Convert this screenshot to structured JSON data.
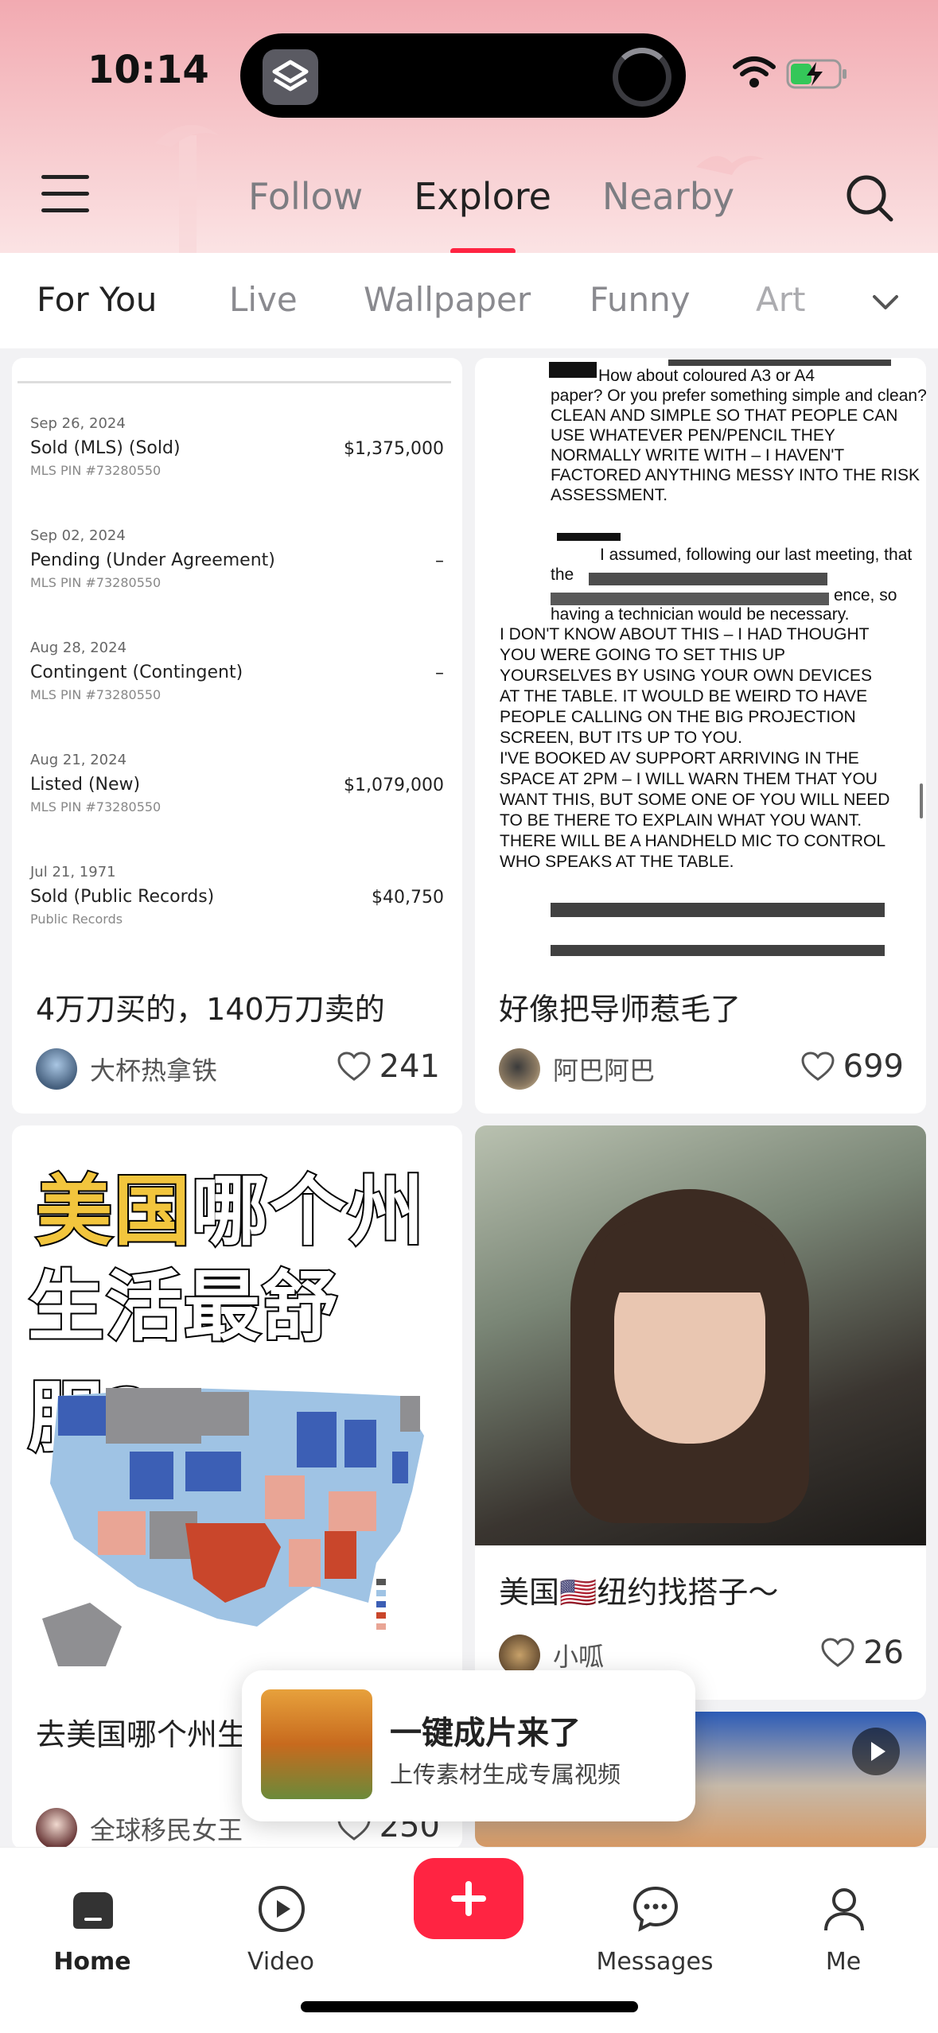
{
  "status": {
    "time": "10:14"
  },
  "header": {
    "tabs": [
      {
        "label": "Follow"
      },
      {
        "label": "Explore"
      },
      {
        "label": "Nearby"
      }
    ],
    "active_tab": "Explore"
  },
  "categories": [
    "For You",
    "Live",
    "Wallpaper",
    "Funny",
    "Art"
  ],
  "cards": {
    "property": {
      "rows": [
        {
          "date": "Sep 26, 2024",
          "status": "Sold (MLS) (Sold)",
          "price": "$1,375,000",
          "sub": "MLS PIN #73280550"
        },
        {
          "date": "Sep 02, 2024",
          "status": "Pending (Under Agreement)",
          "price": "–",
          "sub": "MLS PIN #73280550"
        },
        {
          "date": "Aug 28, 2024",
          "status": "Contingent (Contingent)",
          "price": "–",
          "sub": "MLS PIN #73280550"
        },
        {
          "date": "Aug 21, 2024",
          "status": "Listed (New)",
          "price": "$1,079,000",
          "sub": "MLS PIN #73280550"
        },
        {
          "date": "Jul 21, 1971",
          "status": "Sold (Public Records)",
          "price": "$40,750",
          "sub": "Public Records"
        }
      ],
      "title": "4万刀买的，140万刀卖的",
      "author": "大杯热拿铁",
      "likes": "241"
    },
    "document": {
      "lines": [
        "How about coloured A3 or A4",
        "paper? Or you prefer something simple and clean?",
        "CLEAN AND SIMPLE SO THAT PEOPLE CAN",
        "USE WHATEVER PEN/PENCIL THEY",
        "NORMALLY WRITE WITH – I HAVEN'T",
        "FACTORED ANYTHING MESSY INTO THE RISK",
        "ASSESSMENT.",
        "I assumed, following our last meeting, that",
        "the",
        "ence, so",
        "having a technician would be necessary.",
        "I DON'T KNOW ABOUT THIS – I HAD THOUGHT",
        "YOU WERE GOING TO SET THIS UP",
        "YOURSELVES BY USING YOUR OWN DEVICES",
        "AT THE TABLE. IT WOULD BE WEIRD TO HAVE",
        "PEOPLE CALLING ON THE BIG PROJECTION",
        "SCREEN, BUT ITS UP TO YOU.",
        "I'VE BOOKED AV SUPPORT ARRIVING IN THE",
        "SPACE AT 2PM – I WILL WARN THEM THAT YOU",
        "WANT THIS, BUT SOME ONE OF YOU WILL NEED",
        "TO BE THERE TO EXPLAIN WHAT YOU WANT.",
        "THERE WILL BE A HANDHELD MIC TO CONTROL",
        "WHO SPEAKS AT THE TABLE."
      ],
      "title": "好像把导师惹毛了",
      "author": "阿巴阿巴",
      "likes": "699"
    },
    "map": {
      "headline_highlight": "美国",
      "headline_rest": "哪个州",
      "headline_line2": "生活最舒服?",
      "title": "去美国哪个州生",
      "author": "全球移民女王",
      "likes": "250"
    },
    "selfie": {
      "title": "美国🇺🇸纽约找搭子～",
      "author": "小呱",
      "likes": "26"
    }
  },
  "popup": {
    "title": "一键成片来了",
    "subtitle": "上传素材生成专属视频"
  },
  "nav": {
    "home": "Home",
    "video": "Video",
    "messages": "Messages",
    "me": "Me"
  },
  "colors": {
    "accent": "#ff2442",
    "header_pink": "#f6c4c8"
  }
}
